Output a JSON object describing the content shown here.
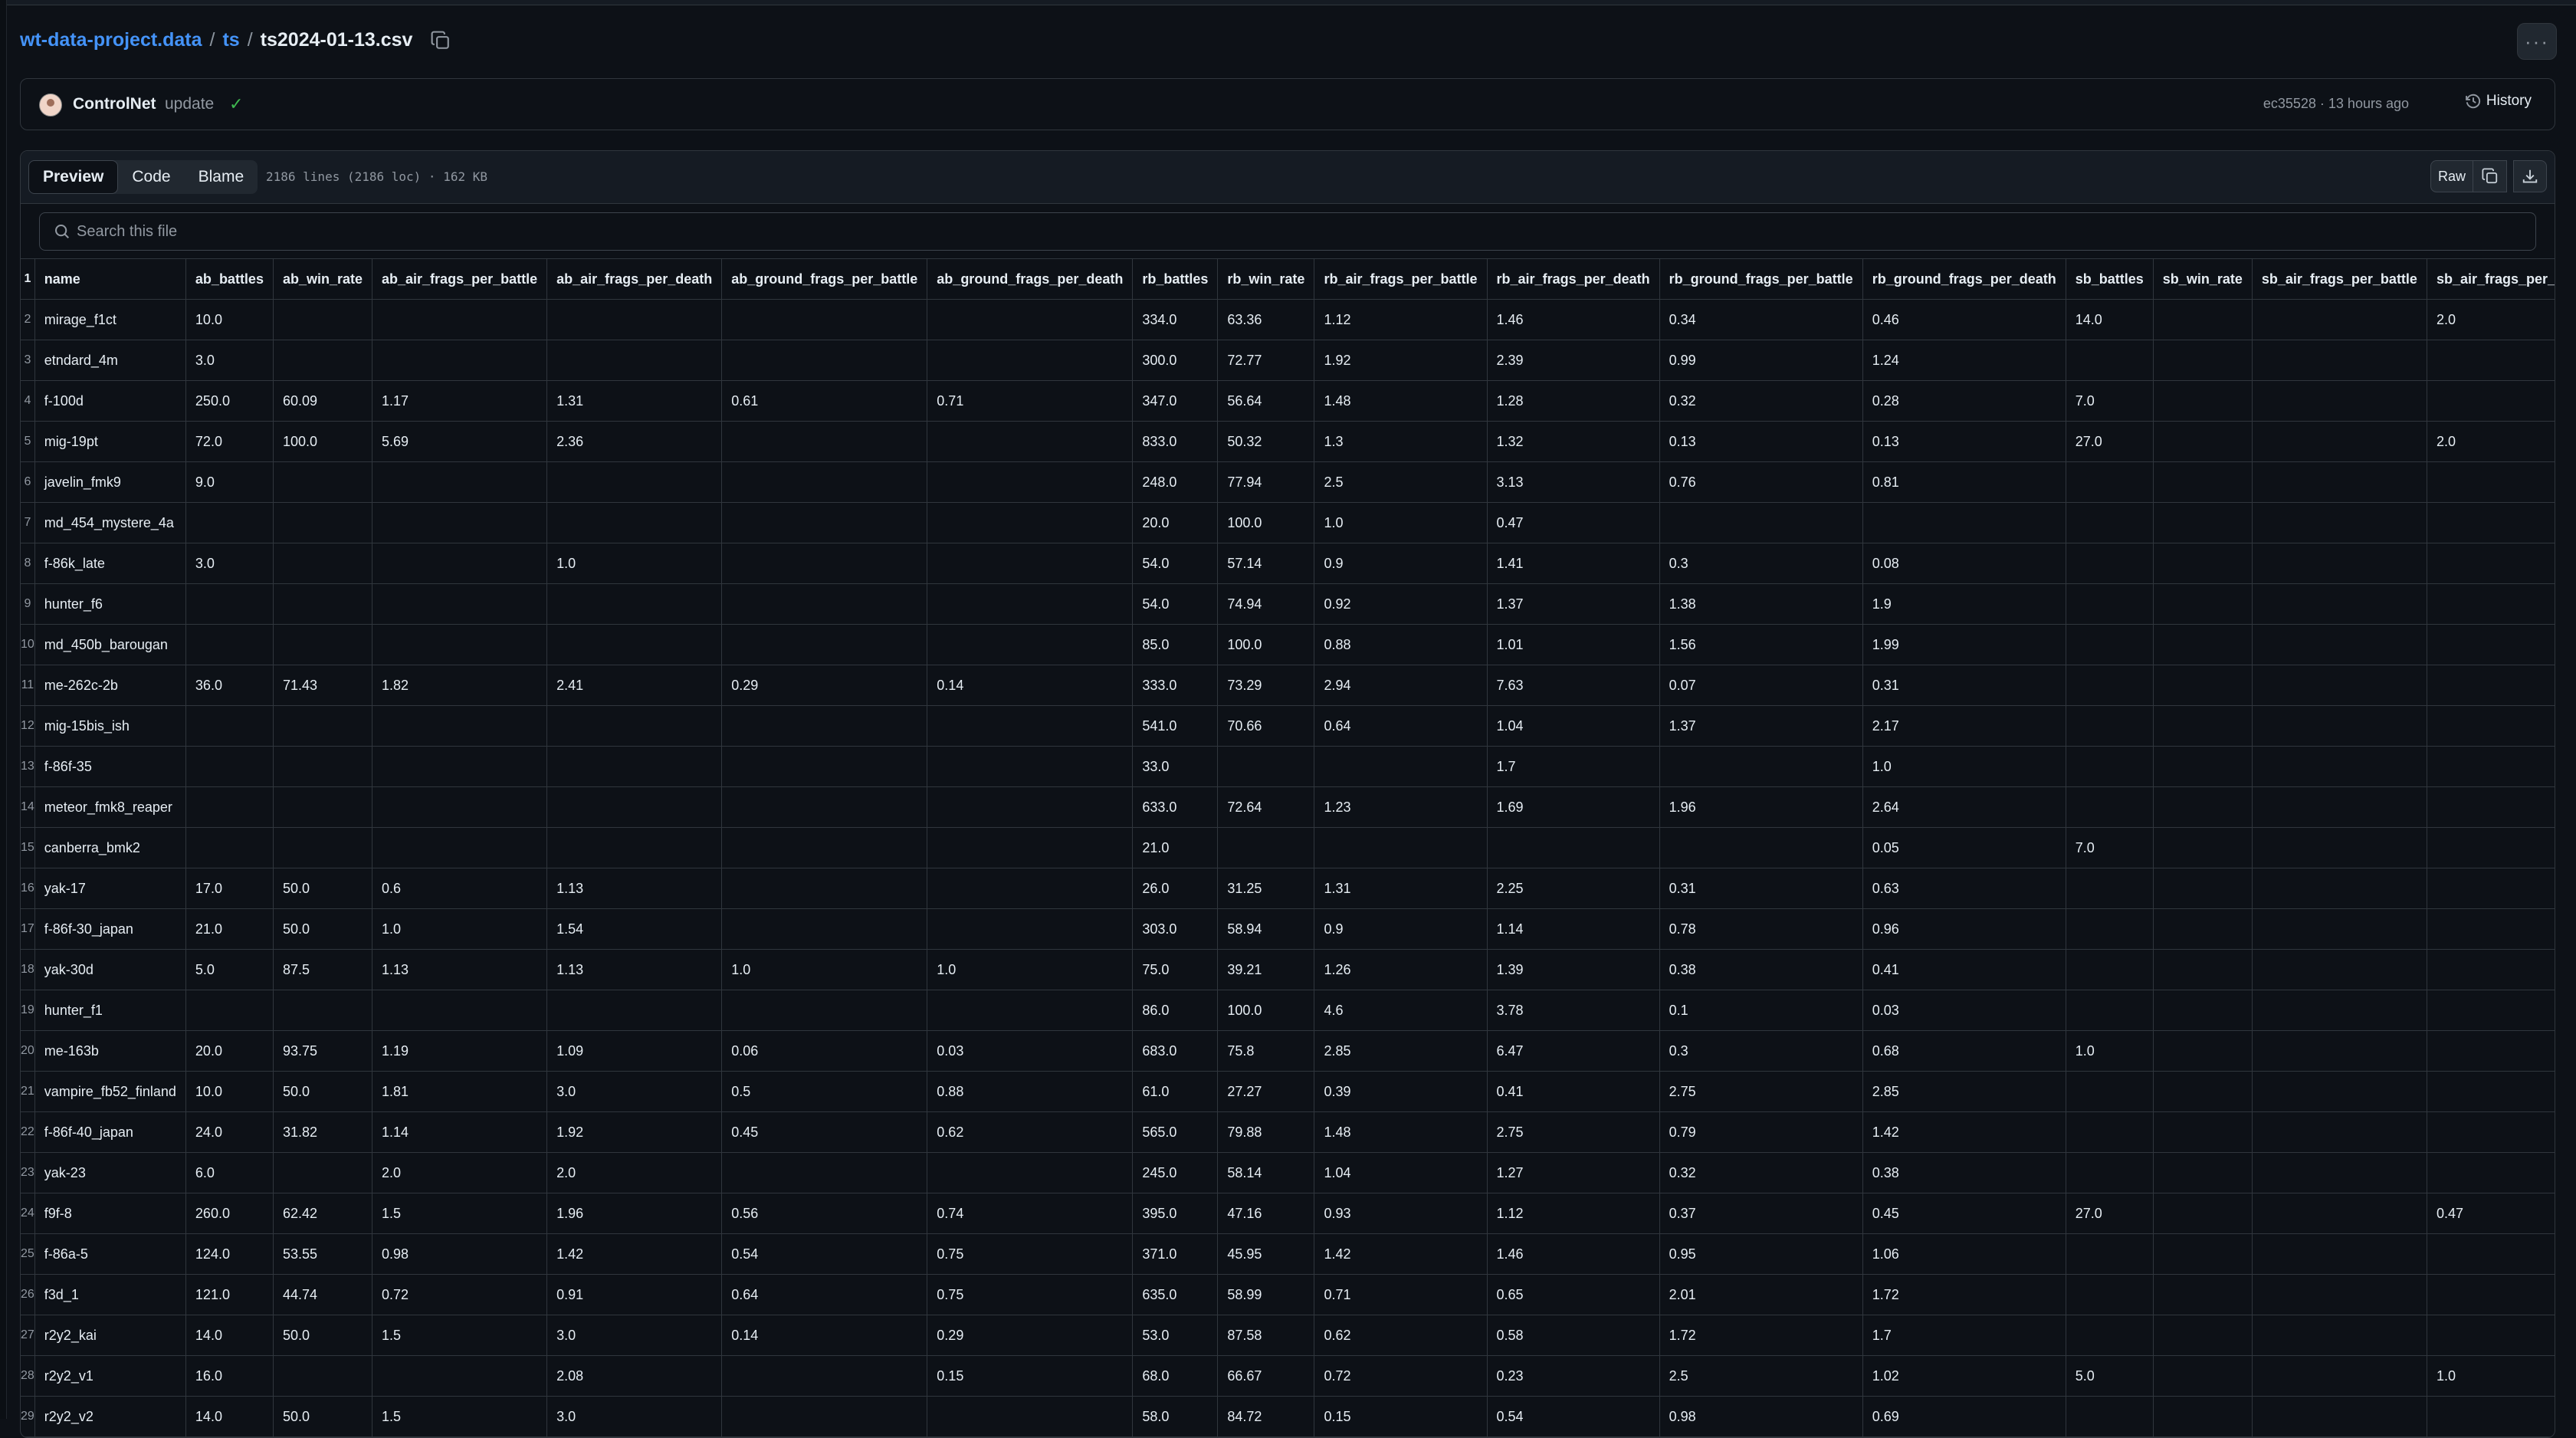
{
  "breadcrumb": {
    "repo": "wt-data-project.data",
    "sep1": "/",
    "folder": "ts",
    "sep2": "/",
    "file": "ts2024-01-13.csv"
  },
  "commit": {
    "author": "ControlNet",
    "message": "update",
    "meta": "ec35528 · 13 hours ago",
    "history_label": "History"
  },
  "file_header": {
    "tabs": [
      "Preview",
      "Code",
      "Blame"
    ],
    "info": "2186 lines (2186 loc) · 162 KB",
    "raw_label": "Raw"
  },
  "search": {
    "placeholder": "Search this file"
  },
  "icons": {
    "copy": "copy-icon",
    "more": "kebab-icon",
    "check": "check-icon",
    "history": "history-icon",
    "search": "search-icon",
    "download": "download-icon"
  },
  "colors": {
    "link": "#4493f8",
    "success": "#3fb950",
    "bg": "#0d1117"
  },
  "table": {
    "headers": [
      "name",
      "ab_battles",
      "ab_win_rate",
      "ab_air_frags_per_battle",
      "ab_air_frags_per_death",
      "ab_ground_frags_per_battle",
      "ab_ground_frags_per_death",
      "rb_battles",
      "rb_win_rate",
      "rb_air_frags_per_battle",
      "rb_air_frags_per_death",
      "rb_ground_frags_per_battle",
      "rb_ground_frags_per_death",
      "sb_battles",
      "sb_win_rate",
      "sb_air_frags_per_battle",
      "sb_air_frags_per_death"
    ],
    "rows": [
      [
        "mirage_f1ct",
        "10.0",
        "",
        "",
        "",
        "",
        "",
        "334.0",
        "63.36",
        "1.12",
        "1.46",
        "0.34",
        "0.46",
        "14.0",
        "",
        "",
        "2.0"
      ],
      [
        "etndard_4m",
        "3.0",
        "",
        "",
        "",
        "",
        "",
        "300.0",
        "72.77",
        "1.92",
        "2.39",
        "0.99",
        "1.24",
        "",
        "",
        "",
        ""
      ],
      [
        "f-100d",
        "250.0",
        "60.09",
        "1.17",
        "1.31",
        "0.61",
        "0.71",
        "347.0",
        "56.64",
        "1.48",
        "1.28",
        "0.32",
        "0.28",
        "7.0",
        "",
        "",
        ""
      ],
      [
        "mig-19pt",
        "72.0",
        "100.0",
        "5.69",
        "2.36",
        "",
        "",
        "833.0",
        "50.32",
        "1.3",
        "1.32",
        "0.13",
        "0.13",
        "27.0",
        "",
        "",
        "2.0"
      ],
      [
        "javelin_fmk9",
        "9.0",
        "",
        "",
        "",
        "",
        "",
        "248.0",
        "77.94",
        "2.5",
        "3.13",
        "0.76",
        "0.81",
        "",
        "",
        "",
        ""
      ],
      [
        "md_454_mystere_4a",
        "",
        "",
        "",
        "",
        "",
        "",
        "20.0",
        "100.0",
        "1.0",
        "0.47",
        "",
        "",
        "",
        "",
        "",
        ""
      ],
      [
        "f-86k_late",
        "3.0",
        "",
        "",
        "1.0",
        "",
        "",
        "54.0",
        "57.14",
        "0.9",
        "1.41",
        "0.3",
        "0.08",
        "",
        "",
        "",
        ""
      ],
      [
        "hunter_f6",
        "",
        "",
        "",
        "",
        "",
        "",
        "54.0",
        "74.94",
        "0.92",
        "1.37",
        "1.38",
        "1.9",
        "",
        "",
        "",
        ""
      ],
      [
        "md_450b_barougan",
        "",
        "",
        "",
        "",
        "",
        "",
        "85.0",
        "100.0",
        "0.88",
        "1.01",
        "1.56",
        "1.99",
        "",
        "",
        "",
        ""
      ],
      [
        "me-262c-2b",
        "36.0",
        "71.43",
        "1.82",
        "2.41",
        "0.29",
        "0.14",
        "333.0",
        "73.29",
        "2.94",
        "7.63",
        "0.07",
        "0.31",
        "",
        "",
        "",
        ""
      ],
      [
        "mig-15bis_ish",
        "",
        "",
        "",
        "",
        "",
        "",
        "541.0",
        "70.66",
        "0.64",
        "1.04",
        "1.37",
        "2.17",
        "",
        "",
        "",
        ""
      ],
      [
        "f-86f-35",
        "",
        "",
        "",
        "",
        "",
        "",
        "33.0",
        "",
        "",
        "1.7",
        "",
        "1.0",
        "",
        "",
        "",
        ""
      ],
      [
        "meteor_fmk8_reaper",
        "",
        "",
        "",
        "",
        "",
        "",
        "633.0",
        "72.64",
        "1.23",
        "1.69",
        "1.96",
        "2.64",
        "",
        "",
        "",
        ""
      ],
      [
        "canberra_bmk2",
        "",
        "",
        "",
        "",
        "",
        "",
        "21.0",
        "",
        "",
        "",
        "",
        "0.05",
        "7.0",
        "",
        "",
        ""
      ],
      [
        "yak-17",
        "17.0",
        "50.0",
        "0.6",
        "1.13",
        "",
        "",
        "26.0",
        "31.25",
        "1.31",
        "2.25",
        "0.31",
        "0.63",
        "",
        "",
        "",
        ""
      ],
      [
        "f-86f-30_japan",
        "21.0",
        "50.0",
        "1.0",
        "1.54",
        "",
        "",
        "303.0",
        "58.94",
        "0.9",
        "1.14",
        "0.78",
        "0.96",
        "",
        "",
        "",
        ""
      ],
      [
        "yak-30d",
        "5.0",
        "87.5",
        "1.13",
        "1.13",
        "1.0",
        "1.0",
        "75.0",
        "39.21",
        "1.26",
        "1.39",
        "0.38",
        "0.41",
        "",
        "",
        "",
        ""
      ],
      [
        "hunter_f1",
        "",
        "",
        "",
        "",
        "",
        "",
        "86.0",
        "100.0",
        "4.6",
        "3.78",
        "0.1",
        "0.03",
        "",
        "",
        "",
        ""
      ],
      [
        "me-163b",
        "20.0",
        "93.75",
        "1.19",
        "1.09",
        "0.06",
        "0.03",
        "683.0",
        "75.8",
        "2.85",
        "6.47",
        "0.3",
        "0.68",
        "1.0",
        "",
        "",
        ""
      ],
      [
        "vampire_fb52_finland",
        "10.0",
        "50.0",
        "1.81",
        "3.0",
        "0.5",
        "0.88",
        "61.0",
        "27.27",
        "0.39",
        "0.41",
        "2.75",
        "2.85",
        "",
        "",
        "",
        ""
      ],
      [
        "f-86f-40_japan",
        "24.0",
        "31.82",
        "1.14",
        "1.92",
        "0.45",
        "0.62",
        "565.0",
        "79.88",
        "1.48",
        "2.75",
        "0.79",
        "1.42",
        "",
        "",
        "",
        ""
      ],
      [
        "yak-23",
        "6.0",
        "",
        "2.0",
        "2.0",
        "",
        "",
        "245.0",
        "58.14",
        "1.04",
        "1.27",
        "0.32",
        "0.38",
        "",
        "",
        "",
        ""
      ],
      [
        "f9f-8",
        "260.0",
        "62.42",
        "1.5",
        "1.96",
        "0.56",
        "0.74",
        "395.0",
        "47.16",
        "0.93",
        "1.12",
        "0.37",
        "0.45",
        "27.0",
        "",
        "",
        "0.47"
      ],
      [
        "f-86a-5",
        "124.0",
        "53.55",
        "0.98",
        "1.42",
        "0.54",
        "0.75",
        "371.0",
        "45.95",
        "1.42",
        "1.46",
        "0.95",
        "1.06",
        "",
        "",
        "",
        ""
      ],
      [
        "f3d_1",
        "121.0",
        "44.74",
        "0.72",
        "0.91",
        "0.64",
        "0.75",
        "635.0",
        "58.99",
        "0.71",
        "0.65",
        "2.01",
        "1.72",
        "",
        "",
        "",
        ""
      ],
      [
        "r2y2_kai",
        "14.0",
        "50.0",
        "1.5",
        "3.0",
        "0.14",
        "0.29",
        "53.0",
        "87.58",
        "0.62",
        "0.58",
        "1.72",
        "1.7",
        "",
        "",
        "",
        ""
      ],
      [
        "r2y2_v1",
        "16.0",
        "",
        "",
        "2.08",
        "",
        "0.15",
        "68.0",
        "66.67",
        "0.72",
        "0.23",
        "2.5",
        "1.02",
        "5.0",
        "",
        "",
        "1.0"
      ],
      [
        "r2y2_v2",
        "14.0",
        "50.0",
        "1.5",
        "3.0",
        "",
        "",
        "58.0",
        "84.72",
        "0.15",
        "0.54",
        "0.98",
        "0.69",
        "",
        "",
        "",
        ""
      ]
    ]
  }
}
